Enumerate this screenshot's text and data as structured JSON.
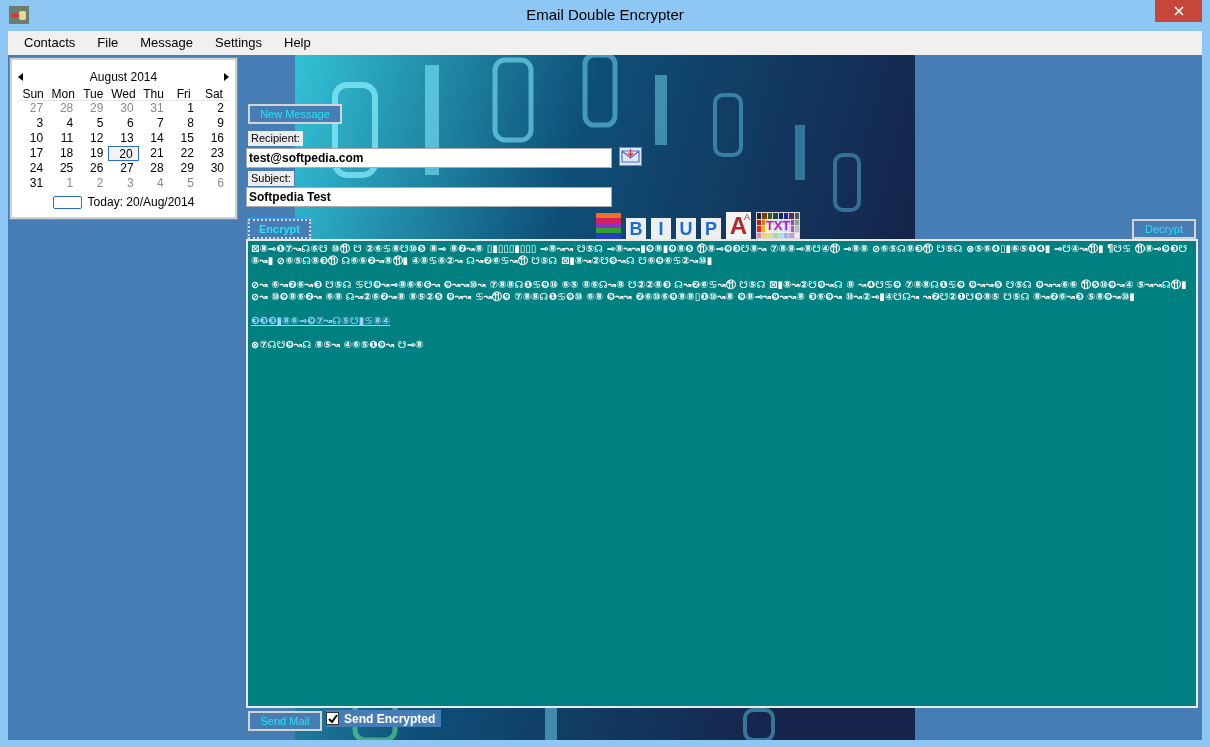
{
  "window": {
    "title": "Email Double Encrypter"
  },
  "menu": [
    "Contacts",
    "File",
    "Message",
    "Settings",
    "Help"
  ],
  "calendar": {
    "month": "August 2014",
    "weekdays": [
      "Sun",
      "Mon",
      "Tue",
      "Wed",
      "Thu",
      "Fri",
      "Sat"
    ],
    "weeks": [
      [
        {
          "day": "27",
          "other": true
        },
        {
          "day": "28",
          "other": true
        },
        {
          "day": "29",
          "other": true
        },
        {
          "day": "30",
          "other": true
        },
        {
          "day": "31",
          "other": true
        },
        {
          "day": "1",
          "other": false
        },
        {
          "day": "2",
          "other": false
        }
      ],
      [
        {
          "day": "3",
          "other": false
        },
        {
          "day": "4",
          "other": false
        },
        {
          "day": "5",
          "other": false
        },
        {
          "day": "6",
          "other": false
        },
        {
          "day": "7",
          "other": false
        },
        {
          "day": "8",
          "other": false
        },
        {
          "day": "9",
          "other": false
        }
      ],
      [
        {
          "day": "10",
          "other": false
        },
        {
          "day": "11",
          "other": false
        },
        {
          "day": "12",
          "other": false
        },
        {
          "day": "13",
          "other": false
        },
        {
          "day": "14",
          "other": false
        },
        {
          "day": "15",
          "other": false
        },
        {
          "day": "16",
          "other": false
        }
      ],
      [
        {
          "day": "17",
          "other": false
        },
        {
          "day": "18",
          "other": false
        },
        {
          "day": "19",
          "other": false
        },
        {
          "day": "20",
          "other": false,
          "selected": true
        },
        {
          "day": "21",
          "other": false
        },
        {
          "day": "22",
          "other": false
        },
        {
          "day": "23",
          "other": false
        }
      ],
      [
        {
          "day": "24",
          "other": false
        },
        {
          "day": "25",
          "other": false
        },
        {
          "day": "26",
          "other": false
        },
        {
          "day": "27",
          "other": false
        },
        {
          "day": "28",
          "other": false
        },
        {
          "day": "29",
          "other": false
        },
        {
          "day": "30",
          "other": false
        }
      ],
      [
        {
          "day": "31",
          "other": false
        },
        {
          "day": "1",
          "other": true
        },
        {
          "day": "2",
          "other": true
        },
        {
          "day": "3",
          "other": true
        },
        {
          "day": "4",
          "other": true
        },
        {
          "day": "5",
          "other": true
        },
        {
          "day": "6",
          "other": true
        }
      ]
    ],
    "today": "Today: 20/Aug/2014"
  },
  "buttons": {
    "new_message": "New Message",
    "encrypt": "Encrypt",
    "decrypt": "Decrypt",
    "send_mail": "Send Mail"
  },
  "recipient": {
    "label": "Recipient:",
    "value": "test@softpedia.com"
  },
  "subject": {
    "label": "Subject:",
    "value": "Softpedia Test"
  },
  "format_tools": [
    {
      "kind": "colors"
    },
    {
      "kind": "text",
      "label": "B"
    },
    {
      "kind": "text",
      "label": "I"
    },
    {
      "kind": "text",
      "label": "U"
    },
    {
      "kind": "text",
      "label": "P"
    },
    {
      "kind": "fontsize",
      "label": "A",
      "small": "A"
    },
    {
      "kind": "palette",
      "label": "TXT"
    }
  ],
  "message": [
    {
      "kind": "text",
      "text": "⊠⑧⊸❶⑦↝☊⑥☋ ⑩⑪ ☋ ②⑥♋⑧☋⑩❺ ⑧⊸ ⑧❷↝⑧ ▯▮▯▯▯▮▯▯▯ ⊸⑧↝↝ ☋⑤☊ ⊸⑧↝↝▮❾⑧▮❾⑧❺ ⑪⑧⊸❾❸☋⑧↝ ⑦⑧⑧⊸⑧☋④⑪ ⊸⑧⑧ ⊘⑥⑤☊⑧❸⑪ ☋⑤☊ ⊗⑤⑥❹▯▮⑥⑤❶❹▮ ⊸☋④↝⑪▮ ¶☋♋ ⑪⑧⊸❾❸☋⑧↝▮ ⊘⑥⑤☊⑧❸⑪ ☊⑥⑥❷↝⑧⑪▮ ④⑧♋⑥②↝ ☊↝❷⑥♋↝⑪ ☋⑤☊ ⊠▮⑧↝②☋❾↝☊ ☋⑥❾⑥♋②↝⑩▮"
    },
    {
      "kind": "text",
      "text": "⊘↝ ⑥↝❷⑥↝❸ ☋⑤☊ ♋☋❾↝⊸⑧⑥⑥❻↝ ❾↝↝⑩↝ ⑦⑧⑧☊❶♋❾⑩ ⑥⑤ ⑧⑥☊↝⑧ ☋②②⑧❸ ☊↝❷⑥♋↝⑪ ☋⑤☊ ⊠▮⑧↝②☋❾↝☊ ⑧ ↝❹☋♋❾ ⑦⑧⑧☊❶♋❾ ❾↝↝❺ ☋⑤☊ ❾↝↝⑥⑥ ⑪❺⑩❾↝④ ⑤↝↝☊⑪▮ ⊘↝ ⑩❾⑧⑥❷↝ ⑥⑧ ☊↝②⑥❷↝⑧ ⑧⑤②❺ ❾↝↝ ♋↝⑪❾ ⑦⑧⑧☊❶♋❾⑩ ⑥⑧ ❾↝↝ ❷⑥⑩⑥❾⑧⑧▯❶⑩↝⑧ ❾⑧⊸↝❾↝↝⑧ ❸⑥❾↝ ⑩↝②⊸▮④☋☊↝ ↝❷☋②❶☋❾⑧⑤ ☋⑤☊ ⑧↝❷⑥↝❸ ⑤⑧❾↝⑩▮"
    },
    {
      "kind": "link",
      "text": "❸❸❸▮⑧⑥⊸❾⑦↝☊⑤☋▮♋⑧④"
    },
    {
      "kind": "text",
      "text": "⊗⑦☊☋❾↝☊ ⑧⑤↝ ④⑥⑤❶❾↝ ☋⊸⑧"
    }
  ],
  "send_encrypted": {
    "label": "Send Encrypted",
    "checked": true
  }
}
